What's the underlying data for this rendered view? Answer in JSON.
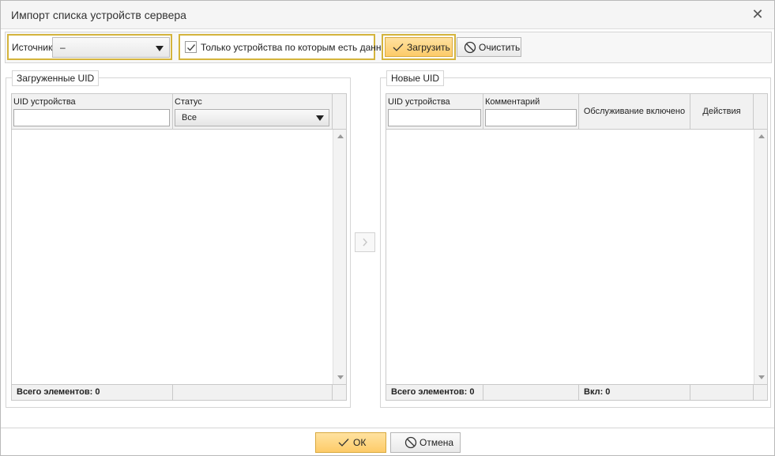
{
  "window": {
    "title": "Импорт списка устройств сервера"
  },
  "toolbar": {
    "source_label": "Источник",
    "source_value": "–",
    "only_with_data_label": "Только устройства по которым есть данные",
    "only_with_data_checked": true,
    "load_label": "Загрузить",
    "clear_label": "Очистить"
  },
  "loaded_panel": {
    "title": "Загруженные UID",
    "columns": [
      "UID устройства",
      "Статус"
    ],
    "status_filter_value": "Все",
    "uid_filter_value": "",
    "rows": [],
    "footer_total": "Всего элементов: 0"
  },
  "new_panel": {
    "title": "Новые UID",
    "columns": [
      "UID устройства",
      "Комментарий",
      "Обслуживание включено",
      "Действия"
    ],
    "uid_filter_value": "",
    "comment_filter_value": "",
    "rows": [],
    "footer_total": "Всего элементов: 0",
    "footer_enabled": "Вкл: 0"
  },
  "dialog_buttons": {
    "ok_label": "ОК",
    "cancel_label": "Отмена"
  },
  "colors": {
    "accent_yellow": "#fdcb68",
    "highlight_border": "#d4b43c"
  }
}
